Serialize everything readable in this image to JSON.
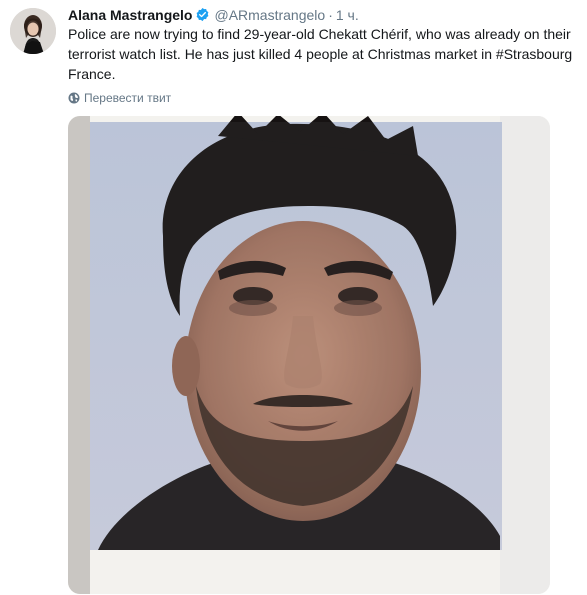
{
  "tweet": {
    "author_name": "Alana Mastrangelo",
    "handle": "@ARmastrangelo",
    "separator": "·",
    "time": "1 ч.",
    "text": "Police are now trying to find 29-year-old Chekatt Chérif, who was already on their terrorist watch list. He has just killed 4 people at Christmas market in #Strasbourg France.",
    "translate_label": "Перевести твит",
    "verified_color": "#1da1f2"
  },
  "icons": {
    "verified": "verified-badge-icon",
    "translate": "globe-icon"
  }
}
